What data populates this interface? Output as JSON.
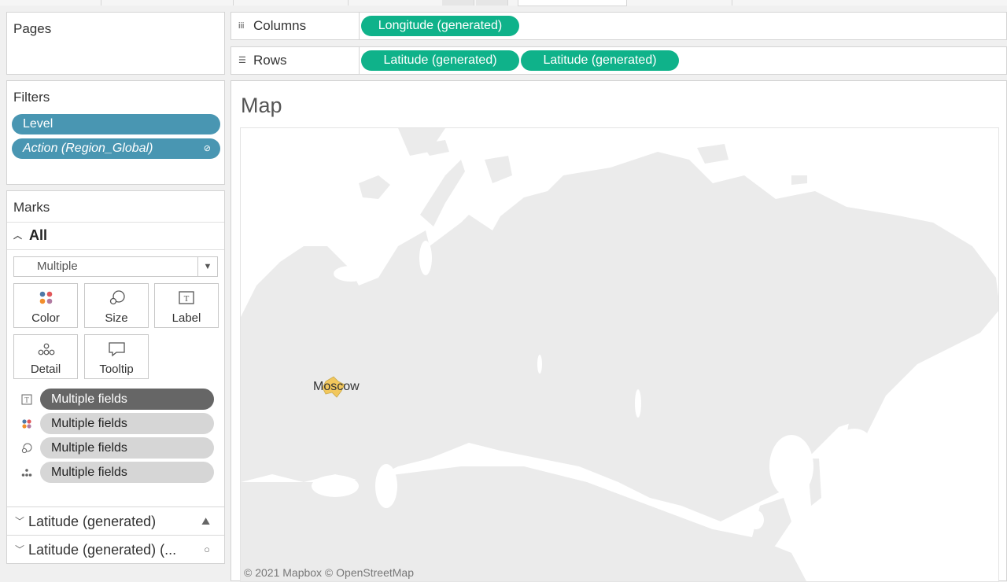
{
  "pages": {
    "title": "Pages"
  },
  "filters": {
    "title": "Filters",
    "items": [
      {
        "label": "Level"
      },
      {
        "label": "Action (Region_Global)"
      }
    ]
  },
  "marks": {
    "title": "Marks",
    "section": "All",
    "mark_type": "Multiple",
    "buttons": {
      "color": "Color",
      "size": "Size",
      "label": "Label",
      "detail": "Detail",
      "tooltip": "Tooltip"
    },
    "fields": [
      {
        "icon": "text-icon",
        "label": "Multiple fields"
      },
      {
        "icon": "color-dots-icon",
        "label": "Multiple fields"
      },
      {
        "icon": "size-icon",
        "label": "Multiple fields"
      },
      {
        "icon": "detail-icon",
        "label": "Multiple fields"
      }
    ],
    "layers": [
      {
        "label": "Latitude (generated)",
        "icon": "map-icon"
      },
      {
        "label": "Latitude (generated) (...",
        "icon": "circle-icon"
      }
    ]
  },
  "columns": {
    "label": "Columns",
    "pills": [
      "Longitude (generated)"
    ]
  },
  "rows": {
    "label": "Rows",
    "pills": [
      "Latitude (generated)",
      "Latitude (generated)"
    ]
  },
  "viz": {
    "title": "Map",
    "map_label": "Moscow",
    "credit": "© 2021 Mapbox © OpenStreetMap"
  },
  "colors": {
    "filter_pill": "#4996b2",
    "green_pill": "#0fb28a",
    "land": "#ebebeb",
    "highlight": "#f2c75c"
  }
}
